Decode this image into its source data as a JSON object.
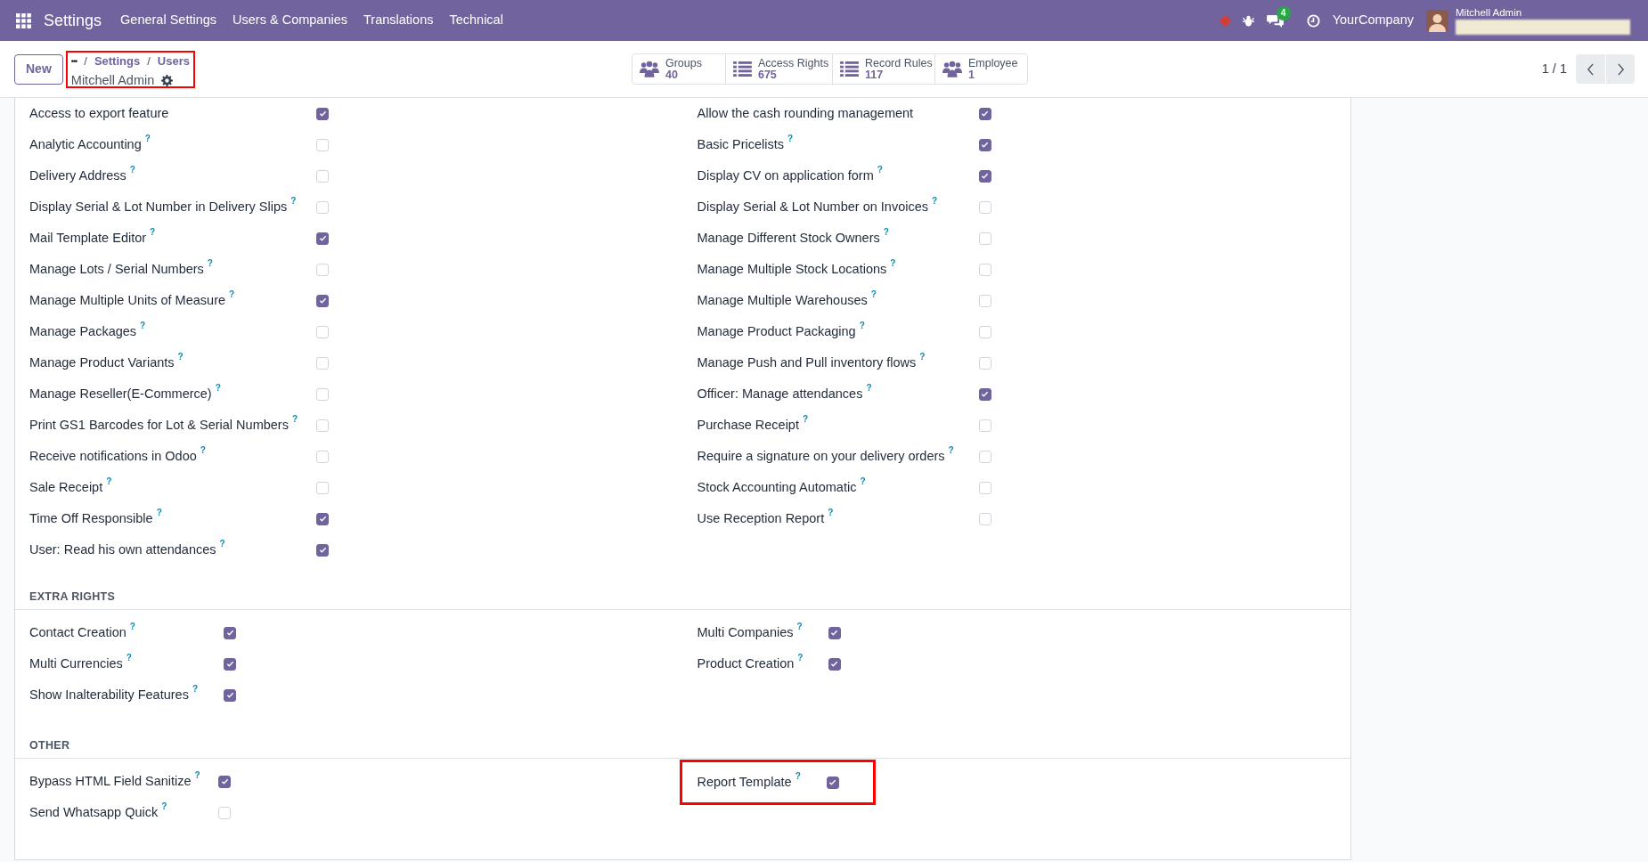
{
  "nav": {
    "app": "Settings",
    "menus": [
      "General Settings",
      "Users & Companies",
      "Translations",
      "Technical"
    ],
    "chat_count": "4",
    "company": "YourCompany",
    "user": "Mitchell Admin"
  },
  "control_panel": {
    "new_button": "New",
    "highlighted": true,
    "breadcrumbs": [
      {
        "label": "•••"
      },
      {
        "separator": "/",
        "label": "Settings"
      },
      {
        "separator": "/",
        "label": "Users"
      }
    ],
    "record_title": "Mitchell Admin",
    "stat_buttons": [
      {
        "kind": "people",
        "label": "Groups",
        "value": "40"
      },
      {
        "kind": "list",
        "label": "Access Rights",
        "value": "675"
      },
      {
        "kind": "list",
        "label": "Record Rules",
        "value": "117"
      },
      {
        "kind": "people",
        "label": "Employee",
        "value": "1"
      }
    ],
    "pager": "1 / 1"
  },
  "sections": [
    {
      "left": [
        {
          "label": "Access to export feature",
          "checked": true,
          "highlighted": false
        },
        {
          "label": "Analytic Accounting",
          "help": "?",
          "checked": false,
          "highlighted": false
        },
        {
          "label": "Delivery Address",
          "help": "?",
          "checked": false,
          "highlighted": false
        },
        {
          "label": "Display Serial & Lot Number in Delivery Slips",
          "help": "?",
          "checked": false,
          "highlighted": false
        },
        {
          "label": "Mail Template Editor",
          "help": "?",
          "checked": true,
          "highlighted": false
        },
        {
          "label": "Manage Lots / Serial Numbers",
          "help": "?",
          "checked": false,
          "highlighted": false
        },
        {
          "label": "Manage Multiple Units of Measure",
          "help": "?",
          "checked": true,
          "highlighted": false
        },
        {
          "label": "Manage Packages",
          "help": "?",
          "checked": false,
          "highlighted": false
        },
        {
          "label": "Manage Product Variants",
          "help": "?",
          "checked": false,
          "highlighted": false
        },
        {
          "label": "Manage Reseller(E-Commerce)",
          "help": "?",
          "checked": false,
          "highlighted": false
        },
        {
          "label": "Print GS1 Barcodes for Lot & Serial Numbers",
          "help": "?",
          "checked": false,
          "highlighted": false
        },
        {
          "label": "Receive notifications in Odoo",
          "help": "?",
          "checked": false,
          "highlighted": false
        },
        {
          "label": "Sale Receipt",
          "help": "?",
          "checked": false,
          "highlighted": false
        },
        {
          "label": "Time Off Responsible",
          "help": "?",
          "checked": true,
          "highlighted": false
        },
        {
          "label": "User: Read his own attendances",
          "help": "?",
          "checked": true,
          "highlighted": false
        }
      ],
      "right": [
        {
          "label": "Allow the cash rounding management",
          "checked": true,
          "highlighted": false
        },
        {
          "label": "Basic Pricelists",
          "help": "?",
          "checked": true,
          "highlighted": false
        },
        {
          "label": "Display CV on application form",
          "help": "?",
          "checked": true,
          "highlighted": false
        },
        {
          "label": "Display Serial & Lot Number on Invoices",
          "help": "?",
          "checked": false,
          "highlighted": false
        },
        {
          "label": "Manage Different Stock Owners",
          "help": "?",
          "checked": false,
          "highlighted": false
        },
        {
          "label": "Manage Multiple Stock Locations",
          "help": "?",
          "checked": false,
          "highlighted": false
        },
        {
          "label": "Manage Multiple Warehouses",
          "help": "?",
          "checked": false,
          "highlighted": false
        },
        {
          "label": "Manage Product Packaging",
          "help": "?",
          "checked": false,
          "highlighted": false
        },
        {
          "label": "Manage Push and Pull inventory flows",
          "help": "?",
          "checked": false,
          "highlighted": false
        },
        {
          "label": "Officer: Manage attendances",
          "help": "?",
          "checked": true,
          "highlighted": false
        },
        {
          "label": "Purchase Receipt",
          "help": "?",
          "checked": false,
          "highlighted": false
        },
        {
          "label": "Require a signature on your delivery orders",
          "help": "?",
          "checked": false,
          "highlighted": false
        },
        {
          "label": "Stock Accounting Automatic",
          "help": "?",
          "checked": false,
          "highlighted": false
        },
        {
          "label": "Use Reception Report",
          "help": "?",
          "checked": false,
          "highlighted": false
        }
      ]
    },
    {
      "title": "EXTRA RIGHTS",
      "left": [
        {
          "label": "Contact Creation",
          "help": "?",
          "checked": true,
          "highlighted": false
        },
        {
          "label": "Multi Currencies",
          "help": "?",
          "checked": true,
          "highlighted": false
        },
        {
          "label": "Show Inalterability Features",
          "help": "?",
          "checked": true,
          "highlighted": false
        }
      ],
      "right": [
        {
          "label": "Multi Companies",
          "help": "?",
          "checked": true,
          "highlighted": false
        },
        {
          "label": "Product Creation",
          "help": "?",
          "checked": true,
          "highlighted": false
        }
      ]
    },
    {
      "title": "OTHER",
      "left": [
        {
          "label": "Bypass HTML Field Sanitize",
          "help": "?",
          "checked": true,
          "highlighted": false
        },
        {
          "label": "Send Whatsapp Quick",
          "help": "?",
          "checked": false,
          "highlighted": false
        }
      ],
      "right": [
        {
          "label": "Report Template",
          "help": "?",
          "checked": true,
          "highlighted": true
        }
      ]
    }
  ]
}
